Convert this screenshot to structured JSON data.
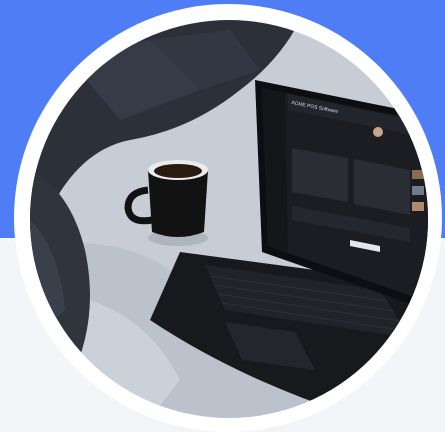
{
  "scene": {
    "colors": {
      "accent_band": "#4f7df5",
      "background": "#f3f5f9",
      "ring": "#ffffff",
      "sheets": "#c9cfd8",
      "pillow": "#2a2f38",
      "laptop": "#15171b",
      "mug": "#121212"
    },
    "icons": [
      "laptop-icon",
      "coffee-mug-icon",
      "pillow-icon"
    ]
  },
  "laptop_screen": {
    "app_title": "ACME POS Software"
  }
}
